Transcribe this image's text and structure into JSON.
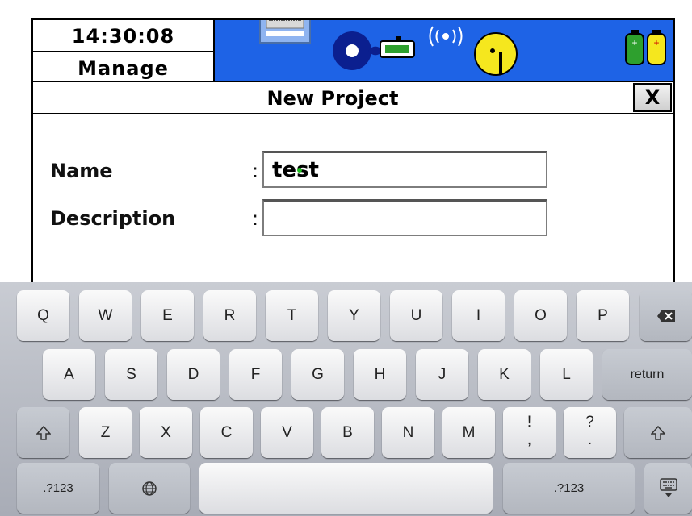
{
  "header": {
    "time": "14:30:08",
    "mode": "Manage"
  },
  "status_icons": [
    "keyboard-icon",
    "cd-disc-icon",
    "usb-connection-icon",
    "wireless-signal-icon",
    "measurement-disc-icon",
    "battery-green-icon",
    "battery-yellow-icon"
  ],
  "colors": {
    "status_bar": "#1e63e6",
    "status_yellow": "#f5e71e",
    "status_green": "#2ea02e",
    "input_indicator": "#20c020"
  },
  "dialog": {
    "title": "New Project",
    "close_label": "X"
  },
  "form": {
    "name_label": "Name",
    "name_colon": ":",
    "name_value": "test",
    "description_label": "Description",
    "description_colon": ":",
    "description_value": ""
  },
  "keyboard": {
    "row1": [
      "Q",
      "W",
      "E",
      "R",
      "T",
      "Y",
      "U",
      "I",
      "O",
      "P"
    ],
    "row2": [
      "A",
      "S",
      "D",
      "F",
      "G",
      "H",
      "J",
      "K",
      "L"
    ],
    "return_label": "return",
    "row3": [
      "Z",
      "X",
      "C",
      "V",
      "B",
      "N",
      "M"
    ],
    "punct1_top": "!",
    "punct1_bottom": ",",
    "punct2_top": "?",
    "punct2_bottom": ".",
    "num_label_left": ".?123",
    "num_label_right": ".?123"
  }
}
